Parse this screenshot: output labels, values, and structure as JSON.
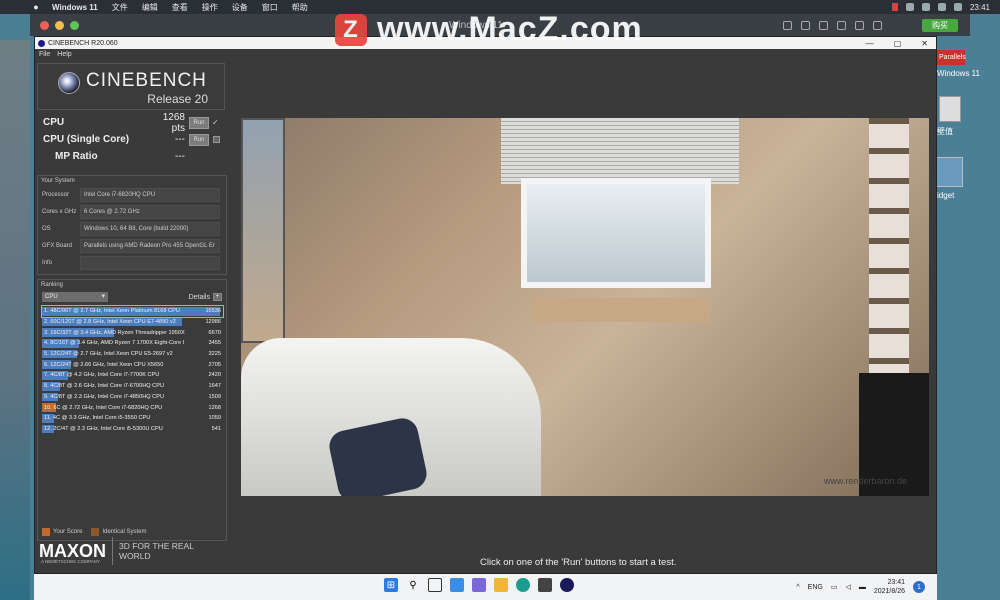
{
  "mac_menubar": {
    "apple": "",
    "app_name": "Windows 11",
    "menus": [
      "文件",
      "编辑",
      "查看",
      "操作",
      "设备",
      "窗口",
      "帮助"
    ],
    "buy_label": "购买",
    "clock": "23:41"
  },
  "vm_window": {
    "title": "Windows 11",
    "buy_label": "购买"
  },
  "watermark": {
    "logo_letter": "Z",
    "text": "www.MacZ.com"
  },
  "desktop_right": {
    "parallels_label": "Parallels",
    "os_label": "Windows 11",
    "thumb_label": "壁值",
    "widget_label": "idget"
  },
  "cinebench": {
    "window_title": "CINEBENCH R20.060",
    "window_controls": {
      "minimize": "—",
      "maximize": "▢",
      "close": "✕"
    },
    "menus": [
      "File",
      "Help"
    ],
    "brand": "CINEBENCH",
    "release": "Release 20",
    "scores": [
      {
        "name": "CPU",
        "value": "1268 pts",
        "run_label": "Run",
        "checked": true
      },
      {
        "name": "CPU (Single Core)",
        "value": "---",
        "run_label": "Run",
        "checked": false
      },
      {
        "name": "MP Ratio",
        "value": "---"
      }
    ],
    "your_system": {
      "title": "Your System",
      "rows": [
        {
          "key": "Processor",
          "value": "Intel Core i7-6820HQ CPU"
        },
        {
          "key": "Cores x GHz",
          "value": "6 Cores @ 2.72 GHz"
        },
        {
          "key": "OS",
          "value": "Windows 10, 64 Bit, Core (build 22000)"
        },
        {
          "key": "GFX Board",
          "value": "Parallels using AMD Radeon Pro 455 OpenGL Er"
        },
        {
          "key": "Info",
          "value": ""
        }
      ]
    },
    "ranking": {
      "title": "Ranking",
      "select_value": "CPU",
      "details_label": "Details",
      "details_btn": "+",
      "max_score": 16536,
      "items": [
        {
          "label": "1. 48C/96T @ 2.7 GHz, Intel Xeon Platinum 8168 CPU",
          "score": "16536",
          "value": 16536,
          "mine": false
        },
        {
          "label": "2. 60C/120T @ 2.8 GHz, Intel Xeon CPU E7-4890 v2",
          "score": "12986",
          "value": 12986,
          "mine": false
        },
        {
          "label": "3. 16C/32T @ 3.4 GHz, AMD Ryzen Threadripper 1950X",
          "score": "6670",
          "value": 6670,
          "mine": false
        },
        {
          "label": "4. 8C/16T @ 3.4 GHz, AMD Ryzen 7 1700X Eight-Core I",
          "score": "3455",
          "value": 3455,
          "mine": false
        },
        {
          "label": "5. 12C/24T @ 2.7 GHz, Intel Xeon CPU E5-2697 v2",
          "score": "3225",
          "value": 3225,
          "mine": false
        },
        {
          "label": "6. 12C/24T @ 2.66 GHz, Intel Xeon CPU X5650",
          "score": "2705",
          "value": 2705,
          "mine": false
        },
        {
          "label": "7. 4C/8T @ 4.2 GHz, Intel Core i7-7700K CPU",
          "score": "2420",
          "value": 2420,
          "mine": false
        },
        {
          "label": "8. 4C/8T @ 2.6 GHz, Intel Core i7-6700HQ CPU",
          "score": "1647",
          "value": 1647,
          "mine": false
        },
        {
          "label": "9. 4C/8T @ 2.3 GHz, Intel Core i7-4850HQ CPU",
          "score": "1509",
          "value": 1509,
          "mine": false
        },
        {
          "label": "10. 6C @ 2.72 GHz, Intel Core i7-6820HQ CPU",
          "score": "1268",
          "value": 1268,
          "mine": true
        },
        {
          "label": "11. 4C @ 3.3 GHz, Intel Core i5-3550 CPU",
          "score": "1059",
          "value": 1059,
          "mine": false
        },
        {
          "label": "12. 2C/4T @ 2.3 GHz, Intel Core i5-5300U CPU",
          "score": "541",
          "value": 541,
          "mine": false
        }
      ],
      "legend": [
        {
          "label": "Your Score",
          "color": "#c46a2d"
        },
        {
          "label": "Identical System",
          "color": "#8a5a2a"
        }
      ]
    },
    "maxon": {
      "logo": "MAXON",
      "sub": "A NEMETSCHEK COMPANY",
      "tagline": "3D FOR THE REAL WORLD"
    },
    "render_credit": "www.renderbaron.de",
    "status": "Click on one of the 'Run' buttons to start a test."
  },
  "taskbar": {
    "icons": [
      "windows-start",
      "search",
      "task-view",
      "widgets",
      "chat",
      "file-explorer",
      "edge",
      "store",
      "cinebench"
    ],
    "tray_chevron": "^",
    "lang": "ENG",
    "clock_time": "23:41",
    "clock_date": "2021/8/26",
    "notif_count": "1"
  }
}
